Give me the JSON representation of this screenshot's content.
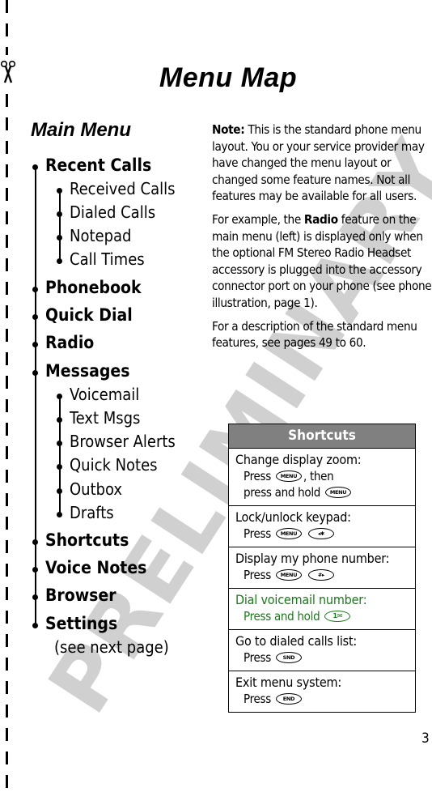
{
  "page": {
    "title": "Menu Map",
    "watermark": "PRELIMINARY",
    "page_number": "3"
  },
  "main_menu": {
    "heading": "Main Menu",
    "items": [
      {
        "label": "Recent Calls",
        "children": [
          "Received Calls",
          "Dialed Calls",
          "Notepad",
          "Call Times"
        ]
      },
      {
        "label": "Phonebook",
        "children": []
      },
      {
        "label": "Quick Dial",
        "children": []
      },
      {
        "label": "Radio",
        "children": []
      },
      {
        "label": "Messages",
        "children": [
          "Voicemail",
          "Text Msgs",
          "Browser Alerts",
          "Quick Notes",
          "Outbox",
          "Drafts"
        ]
      },
      {
        "label": "Shortcuts",
        "children": []
      },
      {
        "label": "Voice Notes",
        "children": []
      },
      {
        "label": "Browser",
        "children": []
      },
      {
        "label": "Settings",
        "children": []
      }
    ],
    "settings_note": "(see next page)"
  },
  "notes": {
    "note_label": "Note:",
    "note_text": " This is the standard phone menu layout. You or your service provider may have changed the menu layout or changed some feature names. Not all features may be available for all users.",
    "example_before": "For example, the ",
    "example_bold": "Radio",
    "example_after": " feature on the main menu (left) is displayed only when the optional FM Stereo Radio Headset accessory is plugged into the accessory connector port on your phone (see phone illustration, page 1).",
    "description": "For a description of the standard menu features, see pages 49 to 60."
  },
  "shortcuts": {
    "header": "Shortcuts",
    "rows": [
      {
        "title": "Change display zoom:",
        "line1_prefix": "Press",
        "line1_key": "MENU",
        "line1_suffix": ", then",
        "line2_prefix": "press and hold",
        "line2_key": "MENU"
      },
      {
        "title": "Lock/unlock keypad:",
        "prefix": "Press",
        "key1": "MENU",
        "key2": "◂✱"
      },
      {
        "title": "Display my phone number:",
        "prefix": "Press",
        "key1": "MENU",
        "key2": "#▸"
      },
      {
        "title": "Dial voicemail number:",
        "prefix": "Press and hold",
        "key1": "1✉",
        "color": "#1a7a1a"
      },
      {
        "title": "Go to dialed calls list:",
        "prefix": "Press",
        "key1": "SND"
      },
      {
        "title": "Exit menu system:",
        "prefix": "Press",
        "key1": "END"
      }
    ]
  },
  "icons": {
    "scissors": "scissors-icon",
    "cut_line": "dashed-cut-line"
  }
}
